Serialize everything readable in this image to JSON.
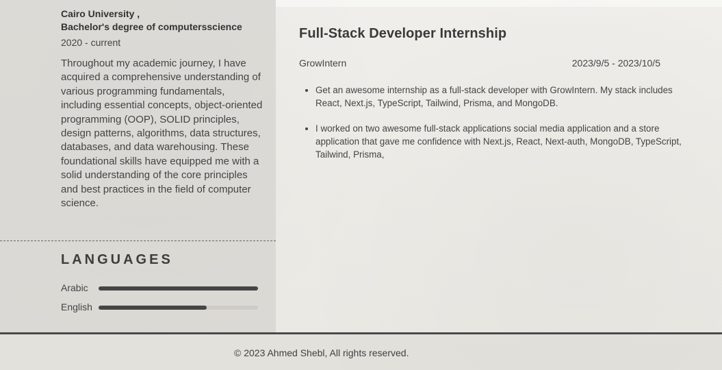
{
  "education": {
    "school": "Cairo University ,",
    "degree": "Bachelor's degree of computersscience",
    "date": "2020 - current",
    "description": "Throughout my academic journey, I have acquired a comprehensive understanding of various programming fundamentals, including essential concepts, object-oriented programming (OOP), SOLID principles, design patterns, algorithms, data structures, databases, and data warehousing. These foundational skills have equipped me with a solid understanding of the core principles and best practices in the field of computer science."
  },
  "languages": {
    "title": "LANGUAGES",
    "items": [
      {
        "name": "Arabic",
        "level": 100
      },
      {
        "name": "English",
        "level": 68
      }
    ]
  },
  "experience": {
    "title": "Full-Stack Developer Internship",
    "company": "GrowIntern",
    "date": "2023/9/5 - 2023/10/5",
    "bullets": [
      "Get an awesome internship as a full-stack developer with GrowIntern. My stack includes React, Next.js, TypeScript, Tailwind, Prisma, and MongoDB.",
      "I worked on two awesome  full-stack applications social media application and a store application that gave me confidence with  Next.js, React, Next-auth, MongoDB, TypeScript, Tailwind, Prisma,"
    ]
  },
  "footer": {
    "text": "© 2023 Ahmed Shebl, All rights reserved."
  }
}
